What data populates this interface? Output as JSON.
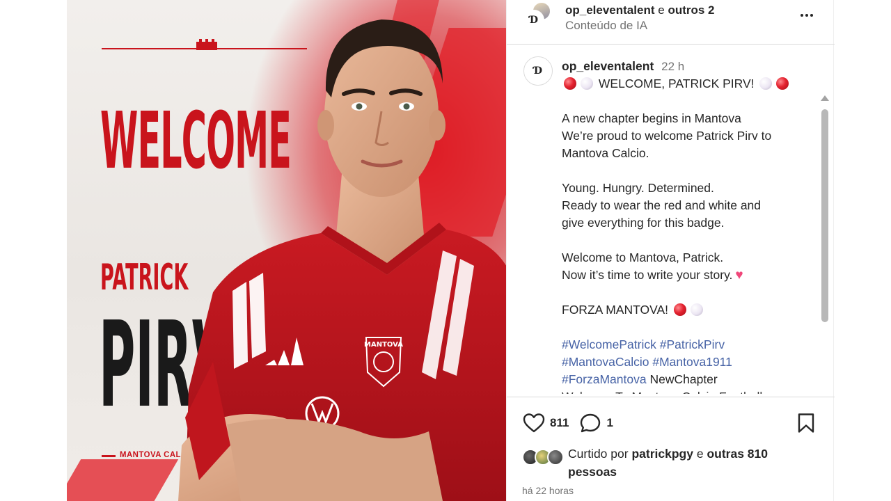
{
  "post_image": {
    "headline": "WELCOME",
    "first_name": "PATRICK",
    "last_name": "PIRV",
    "club": "MANTOVA CALCIO",
    "shirt_badge": "MANTOVA"
  },
  "header": {
    "username": "op_eleventalent",
    "connector": "e",
    "others": "outros 2",
    "subtitle": "Conteúdo de IA"
  },
  "caption": {
    "username": "op_eleventalent",
    "time": "22 h",
    "title": "WELCOME, PATRICK PIRV!",
    "paragraph1": [
      "A new chapter begins in Mantova",
      "We’re proud to welcome Patrick Pirv to",
      "Mantova Calcio."
    ],
    "paragraph2": [
      "Young. Hungry. Determined.",
      "Ready to wear the red and white and",
      "give everything for this badge."
    ],
    "paragraph3": [
      "Welcome to Mantova, Patrick.",
      "Now it’s time to write your story."
    ],
    "forza": "FORZA MANTOVA!",
    "hashtags": {
      "line1a": "#WelcomePatrick",
      "line1b": "#PatrickPirv",
      "line2a": "#MantovaCalcio",
      "line2b": "#Mantova1911",
      "line3a": "#ForzaMantova",
      "line3b": "NewChapter",
      "line4": "Welcome To Mantova Calcio Football"
    }
  },
  "actions": {
    "likes": "811",
    "comments": "1"
  },
  "liked_by": {
    "prefix": "Curtido por",
    "user": "patrickpgy",
    "connector": "e",
    "others": "outras 810",
    "suffix": "pessoas"
  },
  "timestamp": "há 22 horas",
  "colors": {
    "brand_red": "#c9141c",
    "hashtag_blue": "#4763a6",
    "muted_text": "#737373"
  }
}
